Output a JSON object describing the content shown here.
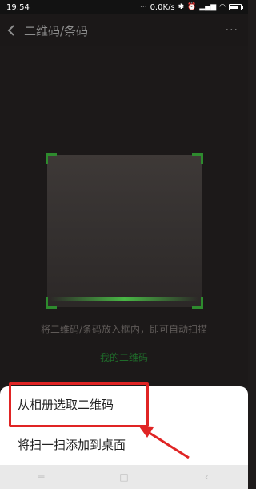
{
  "status_bar": {
    "time": "19:54",
    "right_text": "0.0K/s",
    "icons": [
      "more-dots-icon",
      "bluetooth-icon",
      "alarm-icon",
      "signal-icon",
      "wifi-icon",
      "battery-icon"
    ]
  },
  "header": {
    "title": "二维码/条码",
    "back_icon": "chevron-left-icon",
    "more_icon": "more-dots-icon"
  },
  "scan": {
    "hint": "将二维码/条码放入框内，即可自动扫描",
    "my_qr_label": "我的二维码",
    "accent_color": "#2e8b2e"
  },
  "bottom_sheet": {
    "items": [
      {
        "label": "从相册选取二维码"
      },
      {
        "label": "将扫一扫添加到桌面"
      }
    ],
    "highlight_color": "#e02424"
  },
  "nav_bar": {
    "buttons": [
      "menu-icon",
      "home-icon",
      "back-icon"
    ]
  }
}
